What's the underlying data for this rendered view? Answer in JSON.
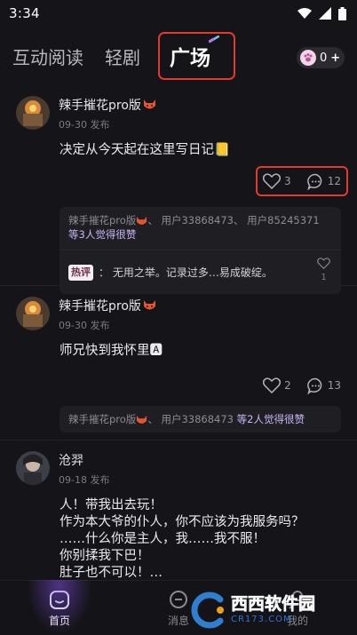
{
  "status_bar": {
    "time": "3:34"
  },
  "tabs": [
    {
      "label": "互动阅读"
    },
    {
      "label": "轻剧"
    },
    {
      "label": "广场"
    }
  ],
  "coins": {
    "count": "0",
    "plus": "+"
  },
  "posts": [
    {
      "author": "辣手摧花pro版",
      "date": "09-30 发布",
      "content": "决定从今天起在这里写日记📒",
      "likes": "3",
      "comments": "12",
      "liked_by_pre": "辣手摧花pro版",
      "liked_by_mid": "、 用户33868473、 用户85245371",
      "liked_by_tail": "等3人觉得很赞",
      "hot_tag": "热评",
      "hot_comment": "： 无用之举。记录过多…易成破绽。",
      "hot_comment_likes": "1"
    },
    {
      "author": "辣手摧花pro版",
      "date": "09-30 发布",
      "content": "师兄快到我怀里🅰",
      "likes": "2",
      "comments": "13",
      "liked_by_pre": "辣手摧花pro版",
      "liked_by_mid": "、 用户33868473 ",
      "liked_by_tail": "等2人觉得很赞"
    },
    {
      "author": "沧羿",
      "date": "09-18 发布",
      "content": "人！带我出去玩！\n作为本大爷的仆人，你不应该为我服务吗？\n……什么你是主人，我……我不服！\n你别揉我下巴！\n肚子也不可以！…"
    }
  ],
  "bottom_nav": [
    {
      "label": "首页"
    },
    {
      "label": "消息"
    },
    {
      "label": "我的"
    }
  ],
  "watermark": {
    "brand": "西西软件园",
    "url": "CR173.COM"
  },
  "colors": {
    "background": "#151418",
    "highlight_box": "#e23a2d",
    "accent": "#c9b6f5",
    "nav_glow": "#7c4edc"
  }
}
